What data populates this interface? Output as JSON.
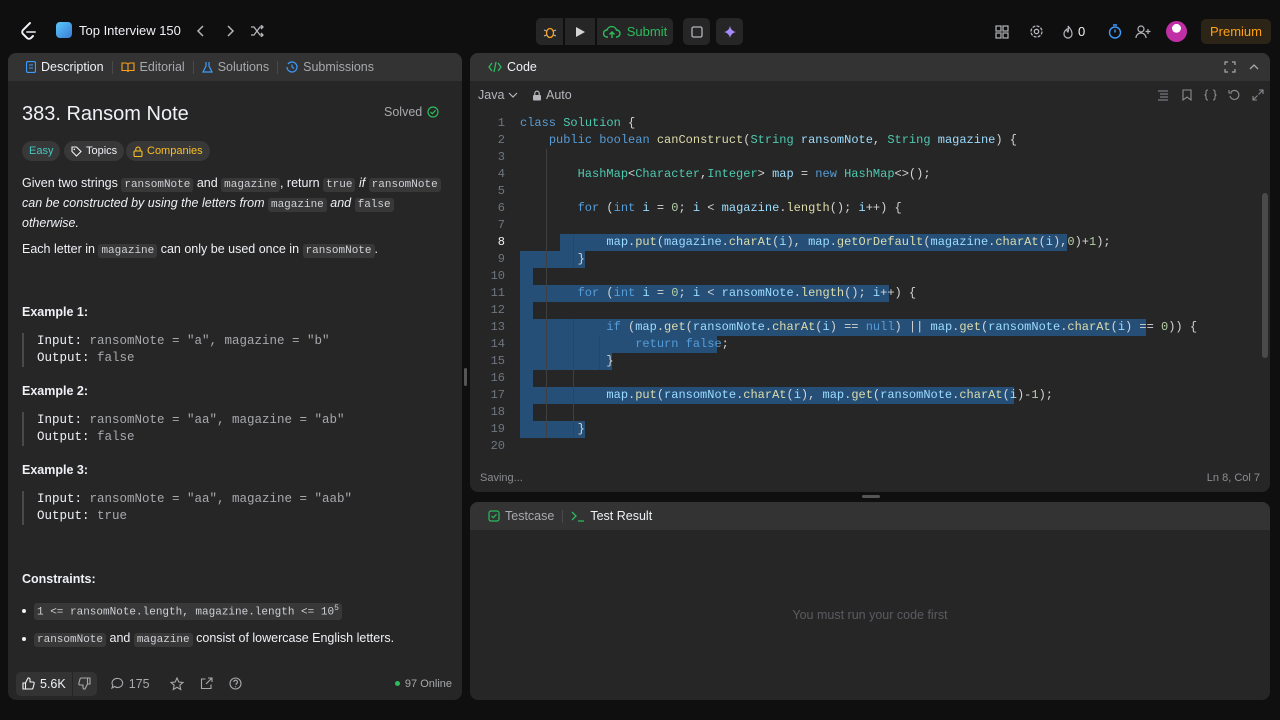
{
  "topbar": {
    "list_name": "Top Interview 150",
    "submit_label": "Submit",
    "streak": "0",
    "premium": "Premium"
  },
  "description_panel": {
    "tabs": [
      "Description",
      "Editorial",
      "Solutions",
      "Submissions"
    ],
    "title": "383. Ransom Note",
    "status": "Solved",
    "chips": [
      "Easy",
      "Topics",
      "Companies"
    ],
    "p1": {
      "a": "Given two strings ",
      "c1": "ransomNote",
      "b": " and ",
      "c2": "magazine",
      "c": ", return ",
      "c3": "true",
      "d": " if ",
      "c4": "ransomNote",
      "e": " can be constructed by using the letters from ",
      "c5": "magazine",
      "f": " and ",
      "c6": "false",
      "g": " otherwise."
    },
    "p2": {
      "a": "Each letter in ",
      "c1": "magazine",
      "b": " can only be used once in ",
      "c2": "ransomNote",
      "c": "."
    },
    "examples": [
      {
        "title": "Example 1:",
        "input_label": "Input:",
        "input": " ransomNote = \"a\", magazine = \"b\"",
        "output_label": "Output:",
        "output": " false"
      },
      {
        "title": "Example 2:",
        "input_label": "Input:",
        "input": " ransomNote = \"aa\", magazine = \"ab\"",
        "output_label": "Output:",
        "output": " false"
      },
      {
        "title": "Example 3:",
        "input_label": "Input:",
        "input": " ransomNote = \"aa\", magazine = \"aab\"",
        "output_label": "Output:",
        "output": " true"
      }
    ],
    "constraints_title": "Constraints:",
    "constraint1": "1 <= ransomNote.length, magazine.length <= 10",
    "constraint1_sup": "5",
    "constraint2": {
      "c1": "ransomNote",
      "a": " and ",
      "c2": "magazine",
      "b": " consist of lowercase English letters."
    },
    "likes": "5.6K",
    "comments": "175",
    "online": "97 Online"
  },
  "code_panel": {
    "tab": "Code",
    "language": "Java",
    "mode": "Auto",
    "status": "Saving...",
    "cursor": "Ln 8, Col 7",
    "current_line": 8,
    "lines": [
      "class Solution {",
      "    public boolean canConstruct(String ransomNote, String magazine) {",
      "",
      "        HashMap<Character,Integer> map = new HashMap<>();",
      "",
      "        for (int i = 0; i < magazine.length(); i++) {",
      "",
      "            map.put(magazine.charAt(i), map.getOrDefault(magazine.charAt(i),0)+1);",
      "        }",
      "",
      "        for (int i = 0; i < ransomNote.length(); i++) {",
      "",
      "            if (map.get(ransomNote.charAt(i) == null) || map.get(ransomNote.charAt(i) == 0)) {",
      "                return false;",
      "            }",
      "",
      "            map.put(ransomNote.charAt(i), map.get(ransomNote.charAt(i)-1);",
      "",
      "        }",
      ""
    ],
    "selected_lines": [
      8,
      9,
      10,
      11,
      12,
      13,
      14,
      15,
      16,
      17,
      18,
      19
    ]
  },
  "test_panel": {
    "tabs": [
      "Testcase",
      "Test Result"
    ],
    "empty_message": "You must run your code first"
  }
}
